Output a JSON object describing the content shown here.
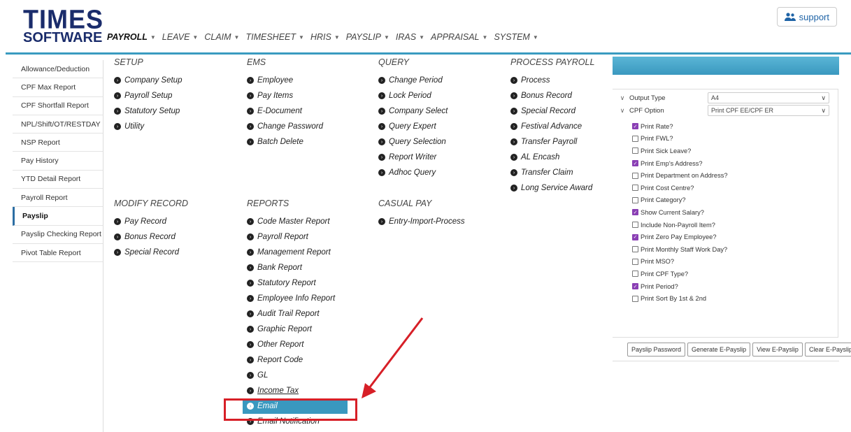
{
  "header": {
    "logo_line1": "TIMES",
    "logo_line2": "SOFTWARE",
    "support_label": "support",
    "nav": [
      {
        "label": "PAYROLL",
        "active": true
      },
      {
        "label": "LEAVE"
      },
      {
        "label": "CLAIM"
      },
      {
        "label": "TIMESHEET"
      },
      {
        "label": "HRIS"
      },
      {
        "label": "PAYSLIP"
      },
      {
        "label": "IRAS"
      },
      {
        "label": "APPRAISAL"
      },
      {
        "label": "SYSTEM"
      }
    ]
  },
  "sidebar": {
    "items": [
      "Allowance/Deduction",
      "CPF Max Report",
      "CPF Shortfall Report",
      "NPL/Shift/OT/RESTDAY",
      "NSP Report",
      "Pay History",
      "YTD Detail Report",
      "Payroll Report",
      "Payslip",
      "Payslip Checking Report",
      "Pivot Table Report"
    ],
    "active": "Payslip"
  },
  "menu": {
    "setup": {
      "title": "SETUP",
      "items": [
        "Company Setup",
        "Payroll Setup",
        "Statutory Setup",
        "Utility"
      ]
    },
    "ems": {
      "title": "EMS",
      "items": [
        "Employee",
        "Pay Items",
        "E-Document",
        "Change Password",
        "Batch Delete"
      ]
    },
    "query": {
      "title": "QUERY",
      "items": [
        "Change Period",
        "Lock Period",
        "Company Select",
        "Query Expert",
        "Query Selection",
        "Report Writer",
        "Adhoc Query"
      ]
    },
    "process": {
      "title": "PROCESS PAYROLL",
      "items": [
        "Process",
        "Bonus Record",
        "Special Record",
        "Festival Advance",
        "Transfer Payroll",
        "AL Encash",
        "Transfer Claim",
        "Long Service Award"
      ]
    },
    "modify": {
      "title": "MODIFY RECORD",
      "items": [
        "Pay Record",
        "Bonus Record",
        "Special Record"
      ]
    },
    "reports": {
      "title": "REPORTS",
      "items": [
        "Code Master Report",
        "Payroll Report",
        "Management Report",
        "Bank Report",
        "Statutory Report",
        "Employee Info Report",
        "Audit Trail Report",
        "Graphic Report",
        "Other Report",
        "Report Code",
        "GL",
        "Income Tax",
        "Email",
        "Email Notification"
      ]
    },
    "casual": {
      "title": "CASUAL PAY",
      "items": [
        "Entry-Import-Process"
      ]
    }
  },
  "options": {
    "output_type_label": "Output Type",
    "output_type_value": "A4",
    "cpf_option_label": "CPF Option",
    "cpf_option_value": "Print CPF EE/CPF ER",
    "checkboxes": [
      {
        "label": "Print Rate?",
        "checked": true
      },
      {
        "label": "Print FWL?",
        "checked": false
      },
      {
        "label": "Print Sick Leave?",
        "checked": false
      },
      {
        "label": "Print Emp's Address?",
        "checked": true
      },
      {
        "label": "Print Department on Address?",
        "checked": false
      },
      {
        "label": "Print Cost Centre?",
        "checked": false
      },
      {
        "label": "Print Category?",
        "checked": false
      },
      {
        "label": "Show Current Salary?",
        "checked": true
      },
      {
        "label": "Include Non-Payroll Item?",
        "checked": false
      },
      {
        "label": "Print Zero Pay Employee?",
        "checked": true
      },
      {
        "label": "Print Monthly Staff Work Day?",
        "checked": false
      },
      {
        "label": "Print MSO?",
        "checked": false
      },
      {
        "label": "Print CPF Type?",
        "checked": false
      },
      {
        "label": "Print Period?",
        "checked": true
      },
      {
        "label": "Print Sort By 1st & 2nd",
        "checked": false
      }
    ],
    "buttons": [
      "Payslip Password",
      "Generate E-Payslip",
      "View E-Payslip",
      "Clear E-Payslip"
    ]
  },
  "colors": {
    "accent": "#3a98bf",
    "brand": "#1a2c6b",
    "highlight_box": "#d71f27",
    "checkbox": "#8a3fb4"
  }
}
